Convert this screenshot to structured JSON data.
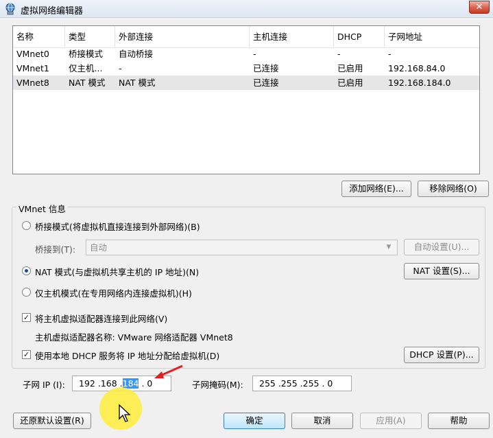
{
  "window": {
    "title": "虚拟网络编辑器",
    "close_glyph": "✕"
  },
  "table": {
    "columns": [
      "名称",
      "类型",
      "外部连接",
      "主机连接",
      "DHCP",
      "子网地址"
    ],
    "rows": [
      [
        "VMnet0",
        "桥接模式",
        "自动桥接",
        "-",
        "-",
        "-"
      ],
      [
        "VMnet1",
        "仅主机...",
        "-",
        "已连接",
        "已启用",
        "192.168.84.0"
      ],
      [
        "VMnet8",
        "NAT 模式",
        "NAT 模式",
        "已连接",
        "已启用",
        "192.168.184.0"
      ]
    ],
    "selected_row": 2
  },
  "buttons": {
    "add_network": "添加网络(E)...",
    "remove_network": "移除网络(O)",
    "auto_settings": "自动设置(U)...",
    "nat_settings": "NAT 设置(S)...",
    "dhcp_settings": "DHCP 设置(P)...",
    "restore_defaults": "还原默认设置(R)",
    "ok": "确定",
    "cancel": "取消",
    "apply": "应用(A)",
    "help": "帮助"
  },
  "vmnet_info": {
    "group_title": "VMnet 信息",
    "bridged_label": "桥接模式(将虚拟机直接连接到外部网络)(B)",
    "bridged_to_label": "桥接到(T):",
    "bridged_to_value": "自动",
    "nat_label": "NAT 模式(与虚拟机共享主机的 IP 地址)(N)",
    "hostonly_label": "仅主机模式(在专用网络内连接虚拟机)(H)",
    "selected_mode": "nat",
    "connect_adapter_label": "将主机虚拟适配器连接到此网络(V)",
    "connect_adapter_checked": true,
    "adapter_name_label": "主机虚拟适配器名称: VMware 网络适配器 VMnet8",
    "use_dhcp_label": "使用本地 DHCP 服务将 IP 地址分配给虚拟机(D)",
    "use_dhcp_checked": true,
    "check_glyph": "✓"
  },
  "subnet": {
    "ip_label": "子网 IP (I):",
    "ip_part_a": "192 .168 .",
    "ip_part_selected": "184",
    "ip_part_b": " . 0",
    "mask_label": "子网掩码(M):",
    "mask_value": "255 .255 .255 . 0"
  }
}
